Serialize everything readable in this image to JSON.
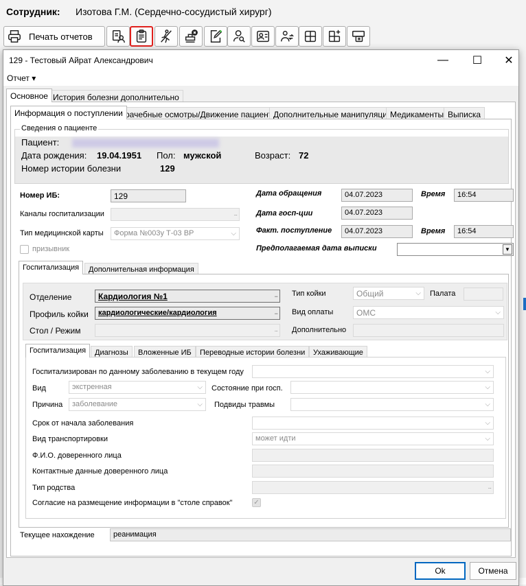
{
  "app": {
    "employee_label": "Сотрудник:",
    "employee_value": "Изотова Г.М. (Сердечно-сосудистый хирург)",
    "toolbar": {
      "print_label": "Печать отчетов",
      "icons": [
        "printer-icon",
        "patient-document-icon",
        "clipboard-icon",
        "person-walking-cross-icon",
        "stamp-delete-icon",
        "edit-document-icon",
        "person-search-icon",
        "person-card-icon",
        "person-transfer-icon",
        "grid-layout-icon",
        "grid-add-icon",
        "bed-icon"
      ]
    },
    "bottom_strip_text": "...   ...                    ...        ..."
  },
  "dialog": {
    "title": "129 - Тестовый Айрат Александрович",
    "controls": {
      "minimize": "—",
      "maximize": "☐",
      "close": "✕"
    },
    "menu": {
      "report": "Отчет ▾"
    },
    "main_tabs": [
      "Основное",
      "История болезни дополнительно"
    ],
    "sub_tabs": [
      "Информация о поступлении",
      "Врачебные осмотры/Движение пациента",
      "Дополнительные манипуляции",
      "Медикаменты",
      "Выписка"
    ],
    "patient_info": {
      "legend": "Сведения о пациенте",
      "patient_label": "Пациент:",
      "birth_label": "Дата рождения:",
      "birth_value": "19.04.1951",
      "sex_label": "Пол:",
      "sex_value": "мужской",
      "age_label": "Возраст:",
      "age_value": "72",
      "history_label": "Номер истории болезни",
      "history_value": "129"
    },
    "admission": {
      "ib_label": "Номер ИБ:",
      "ib_value": "129",
      "channels_label": "Каналы госпитализации",
      "card_type_label": "Тип медицинской карты",
      "card_type_value": "Форма №003у Т-03 ВР",
      "conscript_label": "призывник",
      "request_date_label": "Дата обращения",
      "request_date_value": "04.07.2023",
      "request_time_label": "Время",
      "request_time_value": "16:54",
      "hosp_date_label": "Дата госп-ции",
      "hosp_date_value": "04.07.2023",
      "actual_label": "Факт. поступление",
      "actual_date_value": "04.07.2023",
      "actual_time_label": "Время",
      "actual_time_value": "16:54",
      "expected_discharge_label": "Предполагаемая дата выписки"
    },
    "hosp_tabs": [
      "Госпитализация",
      "Дополнительная информация"
    ],
    "dept": {
      "department_label": "Отделение",
      "department_value": "Кардиология №1",
      "bed_profile_label": "Профиль койки",
      "bed_profile_value": "кардиологические/кардиология",
      "table_mode_label": "Стол / Режим",
      "bed_type_label": "Тип койки",
      "bed_type_value": "Общий",
      "ward_label": "Палата",
      "payment_label": "Вид оплаты",
      "payment_value": "ОМС",
      "additional_label": "Дополнительно"
    },
    "inner_tabs": [
      "Госпитализация",
      "Диагнозы",
      "Вложенные ИБ",
      "Переводные истории болезни",
      "Ухаживающие"
    ],
    "hosp_details": {
      "same_disease_label": "Госпитализирован по данному заболеванию в текущем году",
      "type_label": "Вид",
      "type_value": "экстренная",
      "state_label": "Состояние при госп.",
      "reason_label": "Причина",
      "reason_value": "заболевание",
      "injury_label": "Подвиды травмы",
      "onset_label": "Срок от начала заболевания",
      "transport_label": "Вид транспортировки",
      "transport_value": "может идти",
      "trusted_name_label": "Ф.И.О. доверенного лица",
      "trusted_contact_label": "Контактные данные доверенного лица",
      "kinship_label": "Тип родства",
      "consent_label": "Согласие на размещение информации в \"столе справок\""
    },
    "current_location_label": "Текущее нахождение",
    "current_location_value": "реанимация",
    "ok_label": "Ok",
    "cancel_label": "Отмена"
  }
}
